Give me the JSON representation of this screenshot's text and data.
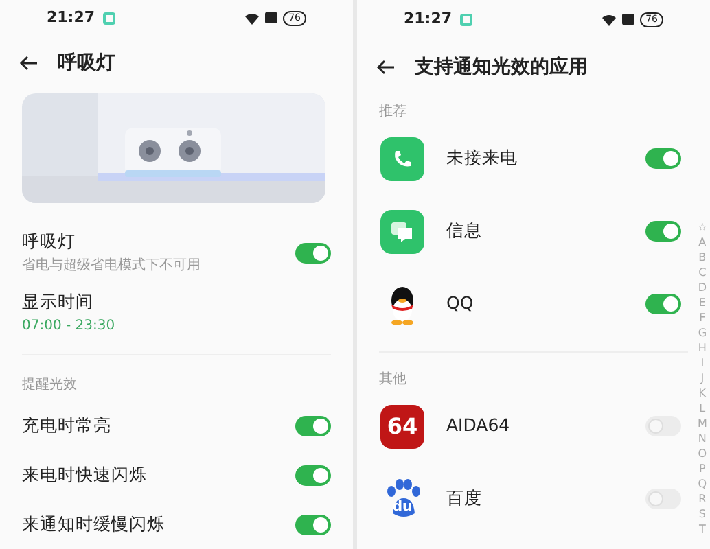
{
  "left_screen": {
    "status_bar": {
      "time": "21:27",
      "battery": "76"
    },
    "title": "呼吸灯",
    "items": [
      {
        "kind": "toggle",
        "label": "呼吸灯",
        "subtitle": "省电与超级省电模式下不可用",
        "on": true
      },
      {
        "kind": "value",
        "label": "显示时间",
        "value": "07:00 - 23:30"
      }
    ],
    "section": {
      "header": "提醒光效",
      "items": [
        {
          "label": "充电时常亮",
          "on": true
        },
        {
          "label": "来电时快速闪烁",
          "on": true
        },
        {
          "label": "来通知时缓慢闪烁",
          "on": true
        }
      ]
    }
  },
  "right_screen": {
    "status_bar": {
      "time": "21:27",
      "battery": "76"
    },
    "title": "支持通知光效的应用",
    "sections": [
      {
        "header": "推荐",
        "apps": [
          {
            "name": "未接来电",
            "kind": "phone",
            "on": true
          },
          {
            "name": "信息",
            "kind": "message",
            "on": true
          },
          {
            "name": "QQ",
            "kind": "penguin",
            "on": true
          }
        ]
      },
      {
        "header": "其他",
        "apps": [
          {
            "name": "AIDA64",
            "kind": "tile",
            "icon_text": "64",
            "on": false
          },
          {
            "name": "百度",
            "kind": "paw",
            "icon_text": "du",
            "on": false
          }
        ]
      }
    ],
    "index": [
      "☆",
      "A",
      "B",
      "C",
      "D",
      "E",
      "F",
      "G",
      "H",
      "I",
      "J",
      "K",
      "L",
      "M",
      "N",
      "O",
      "P",
      "Q",
      "R",
      "S",
      "T"
    ]
  }
}
